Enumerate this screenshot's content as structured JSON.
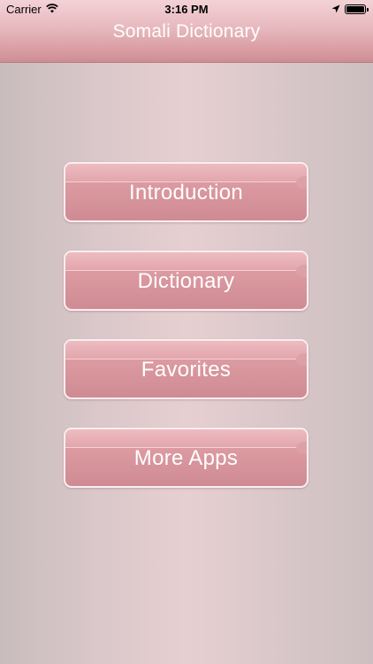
{
  "status_bar": {
    "carrier": "Carrier",
    "time": "3:16 PM",
    "icons": [
      "wifi-icon",
      "location-arrow-icon",
      "battery-icon"
    ]
  },
  "header": {
    "title": "Somali Dictionary"
  },
  "menu": {
    "items": [
      {
        "label": "Introduction"
      },
      {
        "label": "Dictionary"
      },
      {
        "label": "Favorites"
      },
      {
        "label": "More Apps"
      }
    ]
  },
  "colors": {
    "header_top": "#f3d2d6",
    "header_bottom": "#cc8e95",
    "button_fill": "#dd9ba2",
    "button_border": "#fbeef0",
    "text": "#ffffff"
  }
}
